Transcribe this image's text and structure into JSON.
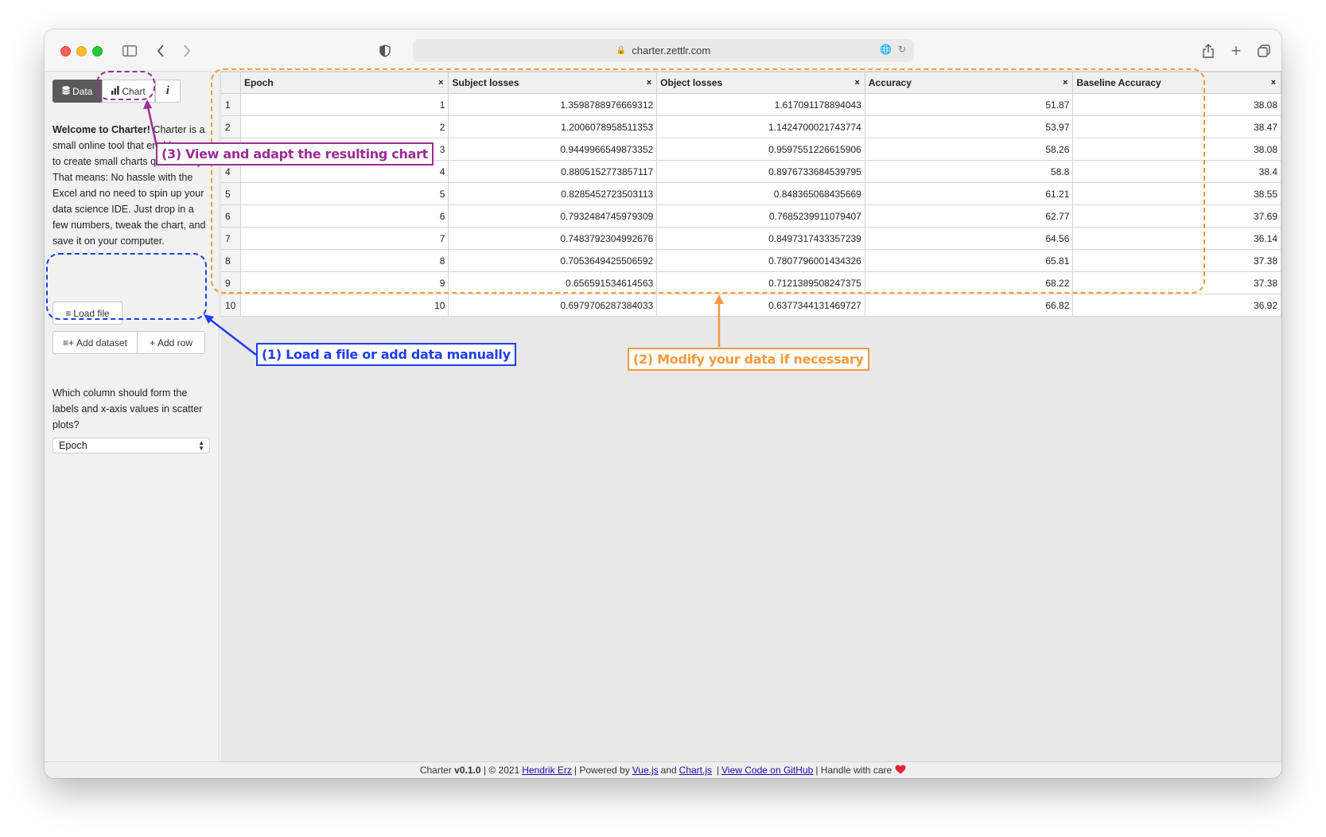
{
  "browser": {
    "url": "charter.zettlr.com"
  },
  "sidebar": {
    "tabs": [
      {
        "label": "Data",
        "icon": "database-icon"
      },
      {
        "label": "Chart",
        "icon": "bar-chart-icon"
      },
      {
        "label": "i",
        "icon": "info-icon"
      }
    ],
    "intro_bold": "Welcome to Charter!",
    "intro_text": " Charter is a small online tool that enables you to create small charts quick'n'dirty. That means: No hassle with the Excel and no need to spin up your data science IDE. Just drop in a few numbers, tweak the chart, and save it on your computer.",
    "load_file": "Load file",
    "add_dataset": "Add dataset",
    "add_row": "Add row",
    "question": "Which column should form the labels and x-axis values in scatter plots?",
    "select_value": "Epoch"
  },
  "table": {
    "columns": [
      "Epoch",
      "Subject losses",
      "Object losses",
      "Accuracy",
      "Baseline Accuracy"
    ],
    "rows": [
      [
        "1",
        "1.3598788976669312",
        "1.617091178894043",
        "51.87",
        "38.08"
      ],
      [
        "2",
        "1.2006078958511353",
        "1.1424700021743774",
        "53.97",
        "38.47"
      ],
      [
        "3",
        "0.9449966549873352",
        "0.9597551226615906",
        "58.26",
        "38.08"
      ],
      [
        "4",
        "0.8805152773857117",
        "0.8976733684539795",
        "58.8",
        "38.4"
      ],
      [
        "5",
        "0.8285452723503113",
        "0.848365068435669",
        "61.21",
        "38.55"
      ],
      [
        "6",
        "0.7932484745979309",
        "0.7685239911079407",
        "62.77",
        "37.69"
      ],
      [
        "7",
        "0.7483792304992676",
        "0.8497317433357239",
        "64.56",
        "36.14"
      ],
      [
        "8",
        "0.7053649425506592",
        "0.7807796001434326",
        "65.81",
        "37.38"
      ],
      [
        "9",
        "0.656591534614563",
        "0.7121389508247375",
        "68.22",
        "37.38"
      ],
      [
        "10",
        "0.6979706287384033",
        "0.6377344131469727",
        "66.82",
        "36.92"
      ]
    ]
  },
  "footer": {
    "app": "Charter",
    "version": "v0.1.0",
    "copyright": "| © 2021",
    "author": "Hendrik Erz",
    "powered": "| Powered by",
    "vue": "Vue.js",
    "and": "and",
    "chartjs": "Chart.js",
    "github": "View Code on GitHub",
    "care": "| Handle with care"
  },
  "annotations": {
    "a1": "(1) Load a file or add data manually",
    "a2": "(2) Modify your data if necessary",
    "a3": "(3) View and adapt the resulting chart"
  },
  "colors": {
    "annot_blue": "#1f3ef0",
    "annot_orange": "#f59a3c",
    "annot_purple": "#9b2e93",
    "heart": "#e0243a"
  }
}
